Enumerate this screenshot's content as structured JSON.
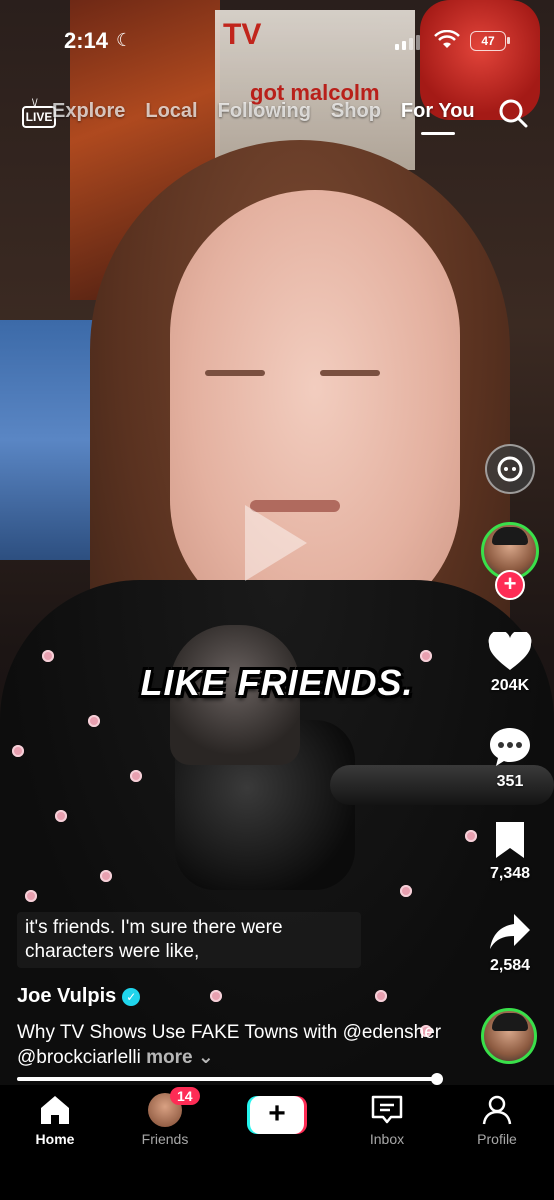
{
  "status_bar": {
    "time": "2:14",
    "battery": "47"
  },
  "top_nav": {
    "live_label": "LIVE",
    "tabs": [
      {
        "label": "Explore"
      },
      {
        "label": "Local"
      },
      {
        "label": "Following"
      },
      {
        "label": "Shop"
      },
      {
        "label": "For You"
      }
    ],
    "active_tab": "For You"
  },
  "video": {
    "on_screen_caption": "LIKE FRIENDS.",
    "subtitle": "it's friends. I'm sure there were characters were like,",
    "author": "Joe Vulpis",
    "description": "Why TV Shows Use FAKE Towns with @edensher @brockciarlelli",
    "more_label": "more",
    "progress": 0.99
  },
  "right_rail": {
    "likes": "204K",
    "comments": "351",
    "saves": "7,348",
    "shares": "2,584"
  },
  "bottom_nav": {
    "home": "Home",
    "friends": "Friends",
    "friends_badge": "14",
    "inbox": "Inbox",
    "profile": "Profile"
  },
  "colors": {
    "accent_red": "#fe2c55",
    "accent_cyan": "#25f4ee",
    "avatar_ring": "#39e04a"
  }
}
